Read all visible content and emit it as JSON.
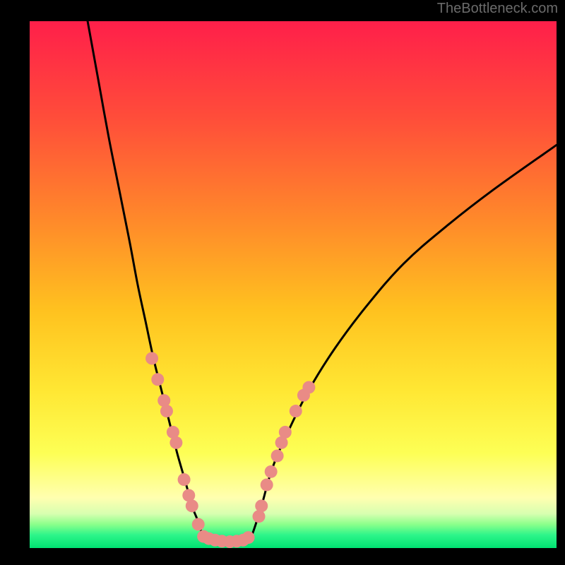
{
  "watermark": "TheBottleneck.com",
  "colors": {
    "top": "#ff1f4a",
    "mid_upper": "#ff7a2a",
    "mid": "#ffd700",
    "lower": "#ffff80",
    "band": "#ffffcc",
    "green_light": "#98ff6e",
    "green": "#00e271",
    "frame": "#000000",
    "curve": "#000000",
    "dots": "#e98b86"
  },
  "chart_data": {
    "type": "line",
    "title": "",
    "xlabel": "",
    "ylabel": "",
    "xlim": [
      0,
      100
    ],
    "ylim": [
      0,
      100
    ],
    "series": [
      {
        "name": "left-arm",
        "x": [
          11,
          13,
          15,
          17,
          19,
          20.5,
          22,
          23.5,
          25,
          26,
          27,
          28,
          29,
          30,
          31,
          32,
          33
        ],
        "y": [
          100,
          89,
          78,
          68,
          58,
          50,
          43,
          36,
          30,
          26,
          22,
          18,
          14.5,
          11,
          7.5,
          5,
          2
        ]
      },
      {
        "name": "valley-floor",
        "x": [
          33,
          34,
          35,
          36,
          37,
          38,
          39,
          40,
          41,
          42
        ],
        "y": [
          2,
          1.5,
          1.2,
          1.1,
          1,
          1,
          1.1,
          1.2,
          1.5,
          2
        ]
      },
      {
        "name": "right-arm",
        "x": [
          42,
          44,
          46,
          49,
          53,
          58,
          64,
          71,
          79,
          88,
          100
        ],
        "y": [
          2,
          8,
          15,
          22,
          30,
          38,
          46,
          54,
          61,
          68,
          76.5
        ]
      }
    ],
    "marker_groups": [
      {
        "name": "left-markers",
        "points": [
          {
            "x": 23.2,
            "y": 36
          },
          {
            "x": 24.3,
            "y": 32
          },
          {
            "x": 25.5,
            "y": 28
          },
          {
            "x": 26.0,
            "y": 26
          },
          {
            "x": 27.2,
            "y": 22
          },
          {
            "x": 27.8,
            "y": 20
          },
          {
            "x": 29.3,
            "y": 13
          },
          {
            "x": 30.2,
            "y": 10
          },
          {
            "x": 30.8,
            "y": 8
          },
          {
            "x": 32.0,
            "y": 4.5
          }
        ]
      },
      {
        "name": "floor-markers",
        "points": [
          {
            "x": 33.0,
            "y": 2.2
          },
          {
            "x": 34.0,
            "y": 1.8
          },
          {
            "x": 35.2,
            "y": 1.5
          },
          {
            "x": 36.5,
            "y": 1.3
          },
          {
            "x": 38.0,
            "y": 1.2
          },
          {
            "x": 39.3,
            "y": 1.3
          },
          {
            "x": 40.5,
            "y": 1.5
          },
          {
            "x": 41.5,
            "y": 2.0
          }
        ]
      },
      {
        "name": "right-markers",
        "points": [
          {
            "x": 43.5,
            "y": 6
          },
          {
            "x": 44.0,
            "y": 8
          },
          {
            "x": 45.0,
            "y": 12
          },
          {
            "x": 45.8,
            "y": 14.5
          },
          {
            "x": 47.0,
            "y": 17.5
          },
          {
            "x": 47.8,
            "y": 20
          },
          {
            "x": 48.5,
            "y": 22
          },
          {
            "x": 50.5,
            "y": 26
          },
          {
            "x": 52.0,
            "y": 29
          },
          {
            "x": 53.0,
            "y": 30.5
          }
        ]
      }
    ]
  }
}
